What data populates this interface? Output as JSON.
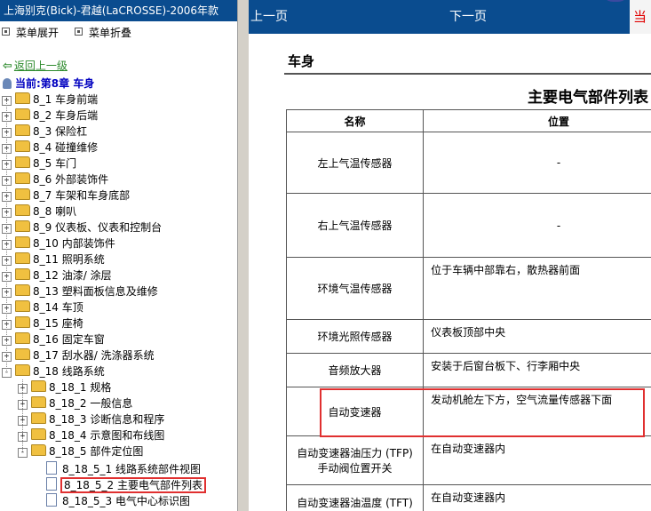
{
  "left_pane": {
    "title": "上海别克(Bick)-君越(LaCROSSE)-2006年款",
    "menu_expand": "菜单展开",
    "menu_collapse": "菜单折叠",
    "back_link": "返回上一级",
    "current": "当前:第8章  车身",
    "tree": [
      {
        "label": "8_1 车身前端",
        "type": "folder",
        "level": 0,
        "exp": "+"
      },
      {
        "label": "8_2 车身后端",
        "type": "folder",
        "level": 0,
        "exp": "+"
      },
      {
        "label": "8_3 保险杠",
        "type": "folder",
        "level": 0,
        "exp": "+"
      },
      {
        "label": "8_4 碰撞维修",
        "type": "folder",
        "level": 0,
        "exp": "+"
      },
      {
        "label": "8_5 车门",
        "type": "folder",
        "level": 0,
        "exp": "+"
      },
      {
        "label": "8_6 外部装饰件",
        "type": "folder",
        "level": 0,
        "exp": "+"
      },
      {
        "label": "8_7 车架和车身底部",
        "type": "folder",
        "level": 0,
        "exp": "+"
      },
      {
        "label": "8_8 喇叭",
        "type": "folder",
        "level": 0,
        "exp": "+"
      },
      {
        "label": "8_9 仪表板、仪表和控制台",
        "type": "folder",
        "level": 0,
        "exp": "+"
      },
      {
        "label": "8_10 内部装饰件",
        "type": "folder",
        "level": 0,
        "exp": "+"
      },
      {
        "label": "8_11 照明系统",
        "type": "folder",
        "level": 0,
        "exp": "+"
      },
      {
        "label": "8_12 油漆/ 涂层",
        "type": "folder",
        "level": 0,
        "exp": "+"
      },
      {
        "label": "8_13 塑料面板信息及维修",
        "type": "folder",
        "level": 0,
        "exp": "+"
      },
      {
        "label": "8_14 车顶",
        "type": "folder",
        "level": 0,
        "exp": "+"
      },
      {
        "label": "8_15 座椅",
        "type": "folder",
        "level": 0,
        "exp": "+"
      },
      {
        "label": "8_16 固定车窗",
        "type": "folder",
        "level": 0,
        "exp": "+"
      },
      {
        "label": "8_17 刮水器/ 洗涤器系统",
        "type": "folder",
        "level": 0,
        "exp": "+"
      },
      {
        "label": "8_18 线路系统",
        "type": "folder",
        "level": 0,
        "exp": "-"
      },
      {
        "label": "8_18_1 规格",
        "type": "folder",
        "level": 1,
        "exp": "+"
      },
      {
        "label": "8_18_2 一般信息",
        "type": "folder",
        "level": 1,
        "exp": "+"
      },
      {
        "label": "8_18_3 诊断信息和程序",
        "type": "folder",
        "level": 1,
        "exp": "+"
      },
      {
        "label": "8_18_4 示意图和布线图",
        "type": "folder",
        "level": 1,
        "exp": "+"
      },
      {
        "label": "8_18_5 部件定位图",
        "type": "folder",
        "level": 1,
        "exp": "-"
      },
      {
        "label": "8_18_5_1 线路系统部件视图",
        "type": "doc",
        "level": 2,
        "exp": ""
      },
      {
        "label": "8_18_5_2 主要电气部件列表",
        "type": "doc",
        "level": 2,
        "exp": "",
        "selected": true
      },
      {
        "label": "8_18_5_3 电气中心标识图",
        "type": "doc",
        "level": 2,
        "exp": ""
      }
    ]
  },
  "right_pane": {
    "prev": "上一页",
    "next": "下一页",
    "current": "当",
    "section": "车身",
    "table_title": "主要电气部件列表",
    "headers": [
      "名称",
      "位置"
    ],
    "rows": [
      {
        "name": "左上气温传感器",
        "pos": "-",
        "center": true
      },
      {
        "name": "右上气温传感器",
        "pos": "-",
        "center": true
      },
      {
        "name": "环境气温传感器",
        "pos": "位于车辆中部靠右，散热器前面",
        "center": false
      },
      {
        "name": "环境光照传感器",
        "pos": "仪表板顶部中央",
        "center": false
      },
      {
        "name": "音频放大器",
        "pos": "安装于后窗台板下、行李厢中央",
        "center": false
      },
      {
        "name": "自动变速器",
        "pos": "发动机舱左下方，空气流量传感器下面",
        "center": false
      },
      {
        "name": "自动变速器油压力 (TFP) 手动阀位置开关",
        "pos": "在自动变速器内",
        "center": false
      },
      {
        "name": "自动变速器油温度 (TFT)",
        "pos": "在自动变速器内",
        "center": false
      }
    ]
  },
  "colors": {
    "titlebar": "#0a4c8f",
    "highlight": "#e03030",
    "link": "#2c8a2c",
    "current": "#0000c0"
  }
}
